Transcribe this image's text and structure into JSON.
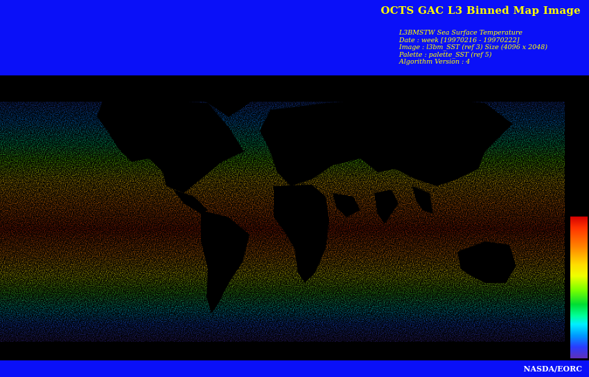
{
  "header": {
    "title": "OCTS GAC L3 Binned Map Image",
    "info_lines": [
      "L3BMSTW Sea Surface Temperature",
      "Date : week [19970216 - 19970222]",
      "Image : l3bm_SST (ref 3) Size (4096 x 2048)",
      "Palette : palette_SST (ref 5)",
      "Algorithm Version : 4"
    ]
  },
  "map": {
    "variable": "Sea Surface Temperature",
    "palette_colors": [
      "#d40000",
      "#ff8800",
      "#ffdd00",
      "#77ff00",
      "#00dd33",
      "#00eeff",
      "#0099ff",
      "#2a3cff",
      "#6030b8"
    ],
    "background_color": "#000000",
    "banner_color": "#0a10f8",
    "text_color": "#ffff00"
  },
  "footer": {
    "credit": "NASDA/EORC"
  }
}
